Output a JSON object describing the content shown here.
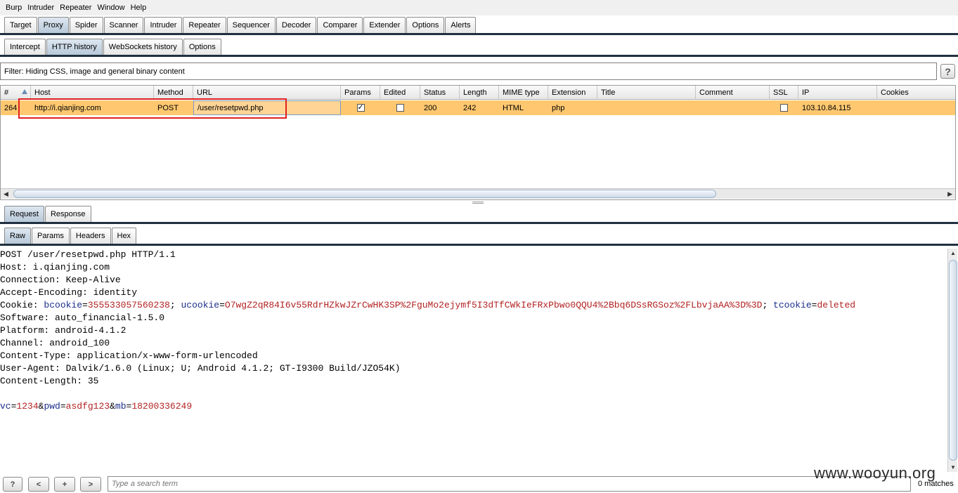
{
  "menu": [
    "Burp",
    "Intruder",
    "Repeater",
    "Window",
    "Help"
  ],
  "main_tabs": [
    "Target",
    "Proxy",
    "Spider",
    "Scanner",
    "Intruder",
    "Repeater",
    "Sequencer",
    "Decoder",
    "Comparer",
    "Extender",
    "Options",
    "Alerts"
  ],
  "proxy_tabs": [
    "Intercept",
    "HTTP history",
    "WebSockets history",
    "Options"
  ],
  "filter": {
    "text": "Filter:  Hiding CSS, image and general binary content",
    "help_label": "?"
  },
  "table": {
    "columns": [
      "#",
      "Host",
      "Method",
      "URL",
      "Params",
      "Edited",
      "Status",
      "Length",
      "MIME type",
      "Extension",
      "Title",
      "Comment",
      "SSL",
      "IP",
      "Cookies"
    ],
    "row": {
      "num": "264",
      "host": "http://i.qianjing.com",
      "method": "POST",
      "url": "/user/resetpwd.php",
      "params": true,
      "edited": false,
      "status": "200",
      "length": "242",
      "mime": "HTML",
      "extension": "php",
      "title": "",
      "comment": "",
      "ssl": false,
      "ip": "103.10.84.115",
      "cookies": ""
    }
  },
  "req_tabs": [
    "Request",
    "Response"
  ],
  "view_tabs": [
    "Raw",
    "Params",
    "Headers",
    "Hex"
  ],
  "request": {
    "line1": "POST /user/resetpwd.php HTTP/1.1",
    "line2": "Host: i.qianjing.com",
    "line3": "Connection: Keep-Alive",
    "line4": "Accept-Encoding: identity",
    "cookie_label": "Cookie: ",
    "c1k": "bcookie",
    "c1v": "355533057560238",
    "c2k": "ucookie",
    "c2v": "O7wgZ2qR84I6v55RdrHZkwJZrCwHK3SP%2FguMo2ejymf5I3dTfCWkIeFRxPbwo0QQU4%2Bbq6DSsRGSoz%2FLbvjaAA%3D%3D",
    "c3k": "tcookie",
    "c3v": "deleted",
    "eq": "=",
    "sep": "; ",
    "line6": "Software: auto_financial-1.5.0",
    "line7": "Platform: android-4.1.2",
    "line8": "Channel: android_100",
    "line9": "Content-Type: application/x-www-form-urlencoded",
    "line10": "User-Agent: Dalvik/1.6.0 (Linux; U; Android 4.1.2; GT-I9300 Build/JZO54K)",
    "line11": "Content-Length: 35",
    "b1k": "vc",
    "b1v": "1234",
    "b2k": "pwd",
    "b2v": "asdfg123",
    "b3k": "mb",
    "b3v": "18200336249",
    "amp": "&"
  },
  "bottom": {
    "help": "?",
    "prev": "<",
    "add": "+",
    "next": ">",
    "search_placeholder": "Type a search term",
    "matches": "0 matches"
  },
  "watermark": "www.wooyun.org"
}
